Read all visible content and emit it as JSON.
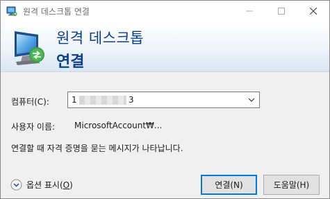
{
  "window": {
    "title": "원격 데스크톱 연결",
    "minimize_icon": "minimize-icon",
    "maximize_icon": "maximize-icon",
    "close_icon": "close-icon"
  },
  "banner": {
    "line1": "원격 데스크톱",
    "line2": "연결",
    "icon": "remote-desktop-monitor-icon"
  },
  "form": {
    "computer_label": "컴퓨터(C):",
    "computer_value_prefix": "1",
    "computer_value_suffix": "3",
    "username_label": "사용자 이름:",
    "username_value": "MicrosoftAccount₩...",
    "message": "연결할 때 자격 증명을 묻는 메시지가 나타납니다."
  },
  "footer": {
    "options_label": "옵션 표시(",
    "options_hotkey": "O",
    "options_close": ")",
    "connect_button": "연결(N)",
    "help_button": "도움말(H)"
  },
  "colors": {
    "accent": "#0078d7",
    "banner_text": "#0b3f8a"
  }
}
